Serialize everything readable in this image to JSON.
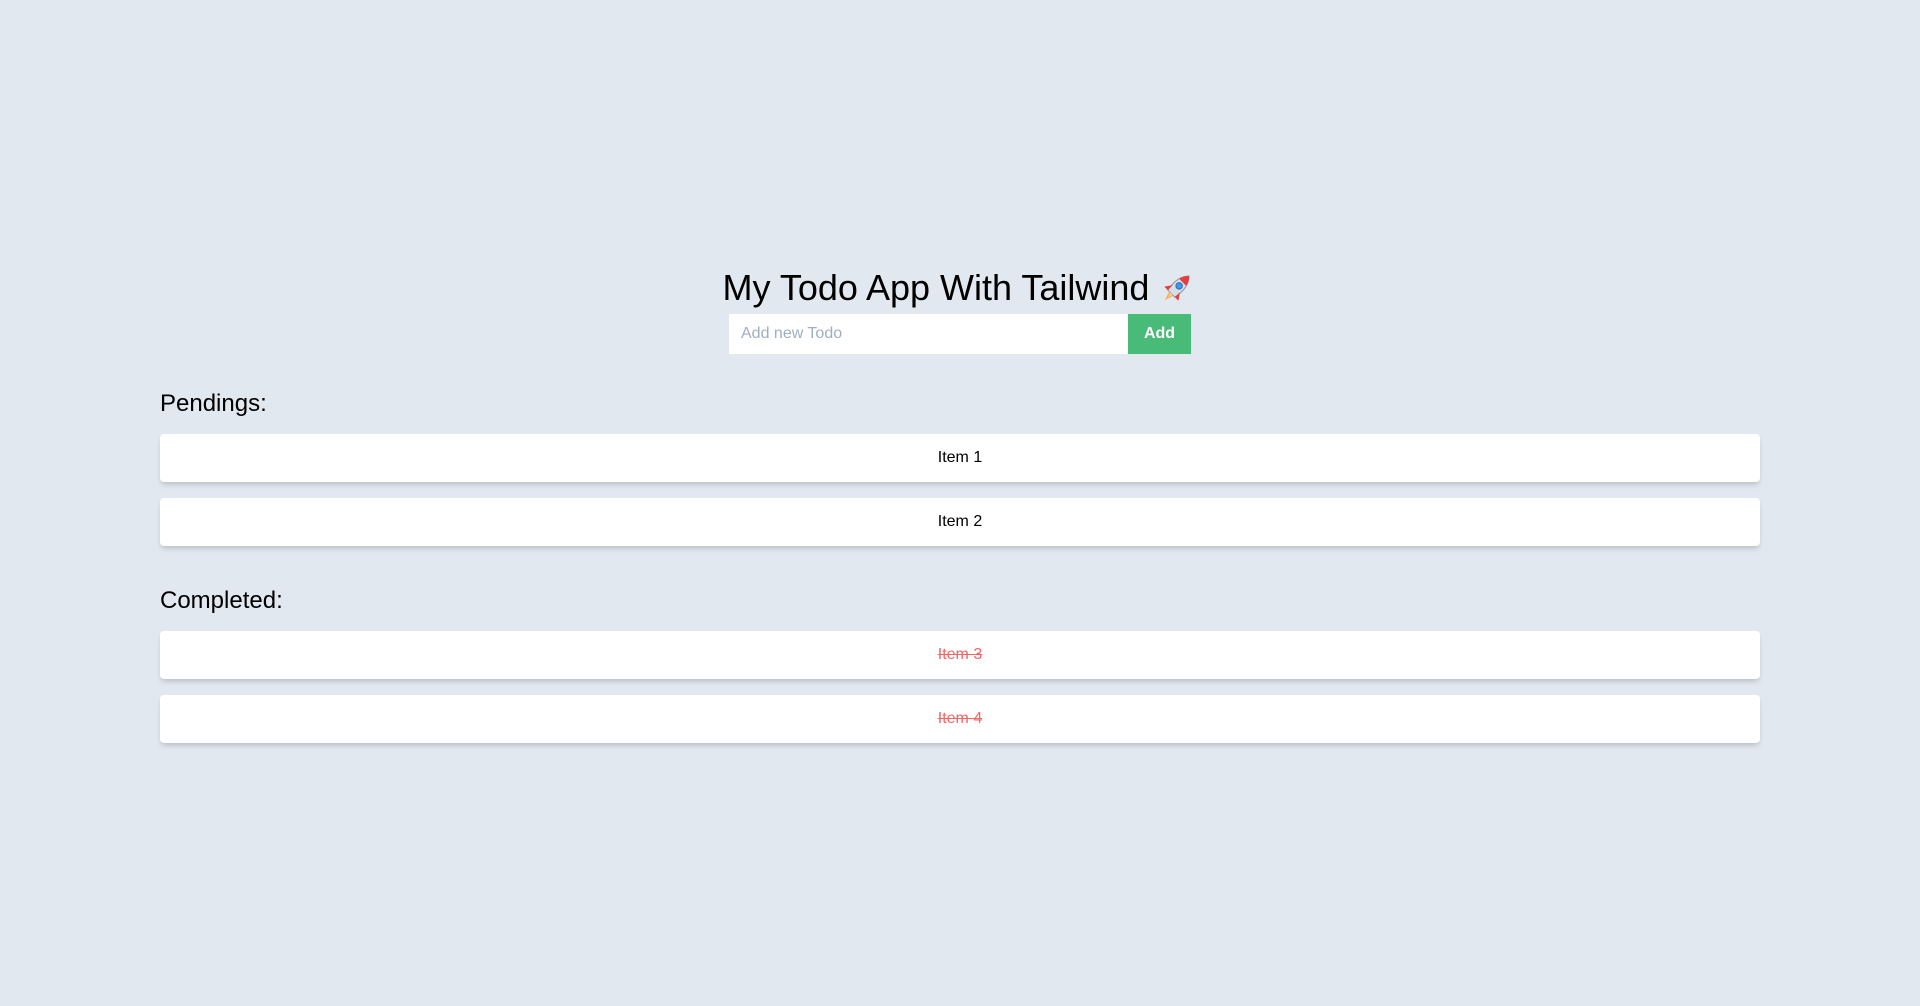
{
  "app": {
    "title": "My Todo App With Tailwind",
    "title_icon": "rocket-icon"
  },
  "add_form": {
    "placeholder": "Add new Todo",
    "value": "",
    "button_label": "Add",
    "button_color": "#48bb78"
  },
  "pending": {
    "heading": "Pendings:",
    "items": [
      {
        "label": "Item 1"
      },
      {
        "label": "Item 2"
      }
    ]
  },
  "completed": {
    "heading": "Completed:",
    "item_color": "#f56565",
    "items": [
      {
        "label": "Item 3"
      },
      {
        "label": "Item 4"
      }
    ]
  },
  "colors": {
    "background": "#e2e8f0",
    "card": "#ffffff"
  }
}
